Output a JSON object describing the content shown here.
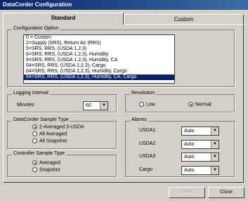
{
  "window": {
    "title": "DataCorder Configuration"
  },
  "tabs": [
    {
      "label": "Standard"
    },
    {
      "label": "Custom"
    }
  ],
  "config_option": {
    "legend": "Configuration Option",
    "items": [
      "0 = Custom",
      "2=Supply (SRS), Return Air (RRS)",
      "5=SRS, RRS, (USDA 1,2,3)",
      "6=SRS, RRS, (USDA 1,2,3), Humidity",
      "9=SRS, RRS, (USDA 1,2,3), Humidity, CA",
      "54=SRS, RRS, (USDA 1,2,3), Cargo",
      "64=SRS, RRS, (USDA 1,2,3), Humidity, Cargo",
      "94=SRS, RRS, (USDA 1,2,3), Humidity, CA, Cargo"
    ],
    "selected_index": 7
  },
  "logging": {
    "legend": "Logging Interval",
    "label": "Minutes",
    "value": "60"
  },
  "resolution": {
    "legend": "Resolution",
    "low": "Low",
    "normal": "Normal",
    "selected": "Normal"
  },
  "sample_type": {
    "legend": "DataCorder Sample Type",
    "options": [
      "2-Averaged 3-USDA",
      "All Averaged",
      "All Snapshot"
    ],
    "selected_index": 0
  },
  "alarms": {
    "legend": "Alarms",
    "rows": [
      {
        "label": "USDA1",
        "value": "Auto"
      },
      {
        "label": "USDA2",
        "value": "Auto"
      },
      {
        "label": "USDA3",
        "value": "Auto"
      },
      {
        "label": "Cargo",
        "value": "Auto"
      }
    ]
  },
  "controller_sample": {
    "legend": "Controller Sample Type",
    "options": [
      "Averaged",
      "Snapshot"
    ],
    "selected_index": 0
  },
  "buttons": {
    "send": "Send",
    "close": "Close"
  }
}
